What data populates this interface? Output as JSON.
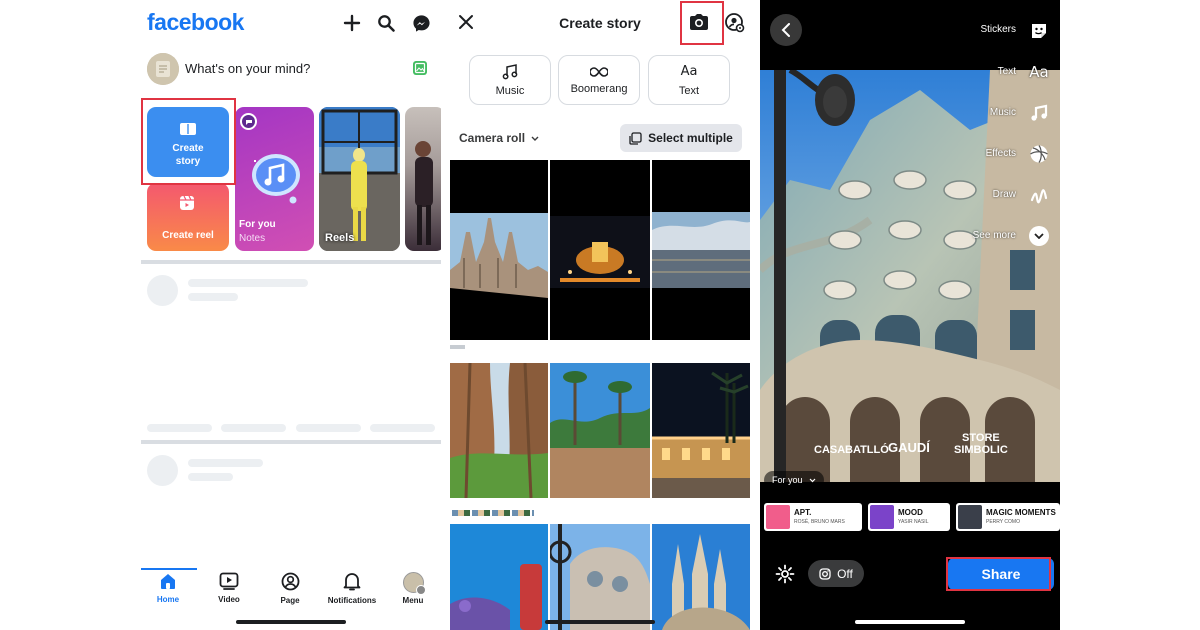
{
  "panel1": {
    "logo": "facebook",
    "composer_placeholder": "What's on your mind?",
    "cards": {
      "create_story": "Create story",
      "create_reel": "Create reel",
      "for_you_title": "For you",
      "for_you_subtitle": "Notes",
      "reels": "Reels"
    },
    "tabs": [
      "Home",
      "Video",
      "Page",
      "Notifications",
      "Menu"
    ],
    "active_tab": "Home"
  },
  "panel2": {
    "title": "Create story",
    "options": [
      "Music",
      "Boomerang",
      "Text"
    ],
    "camera_roll": "Camera roll",
    "select_multiple": "Select multiple"
  },
  "panel3": {
    "tools": [
      "Stickers",
      "Text",
      "Music",
      "Effects",
      "Draw",
      "See more"
    ],
    "facade_signs": [
      "CASA",
      "BATLLÓ",
      "GAUDÍ",
      "STORE\nSIMBOLIC"
    ],
    "for_you": "For you",
    "songs": [
      {
        "title": "APT.",
        "artist": "ROSÉ, BRUNO MARS"
      },
      {
        "title": "MOOD",
        "artist": "YASIR NASIL"
      },
      {
        "title": "MAGIC MOMENTS",
        "artist": "PERRY COMO"
      }
    ],
    "share_to_instagram": "Off",
    "share_button": "Share"
  },
  "colors": {
    "facebook_blue": "#1877f2",
    "highlight_red": "#e03442",
    "share_blue": "#1877f2"
  }
}
